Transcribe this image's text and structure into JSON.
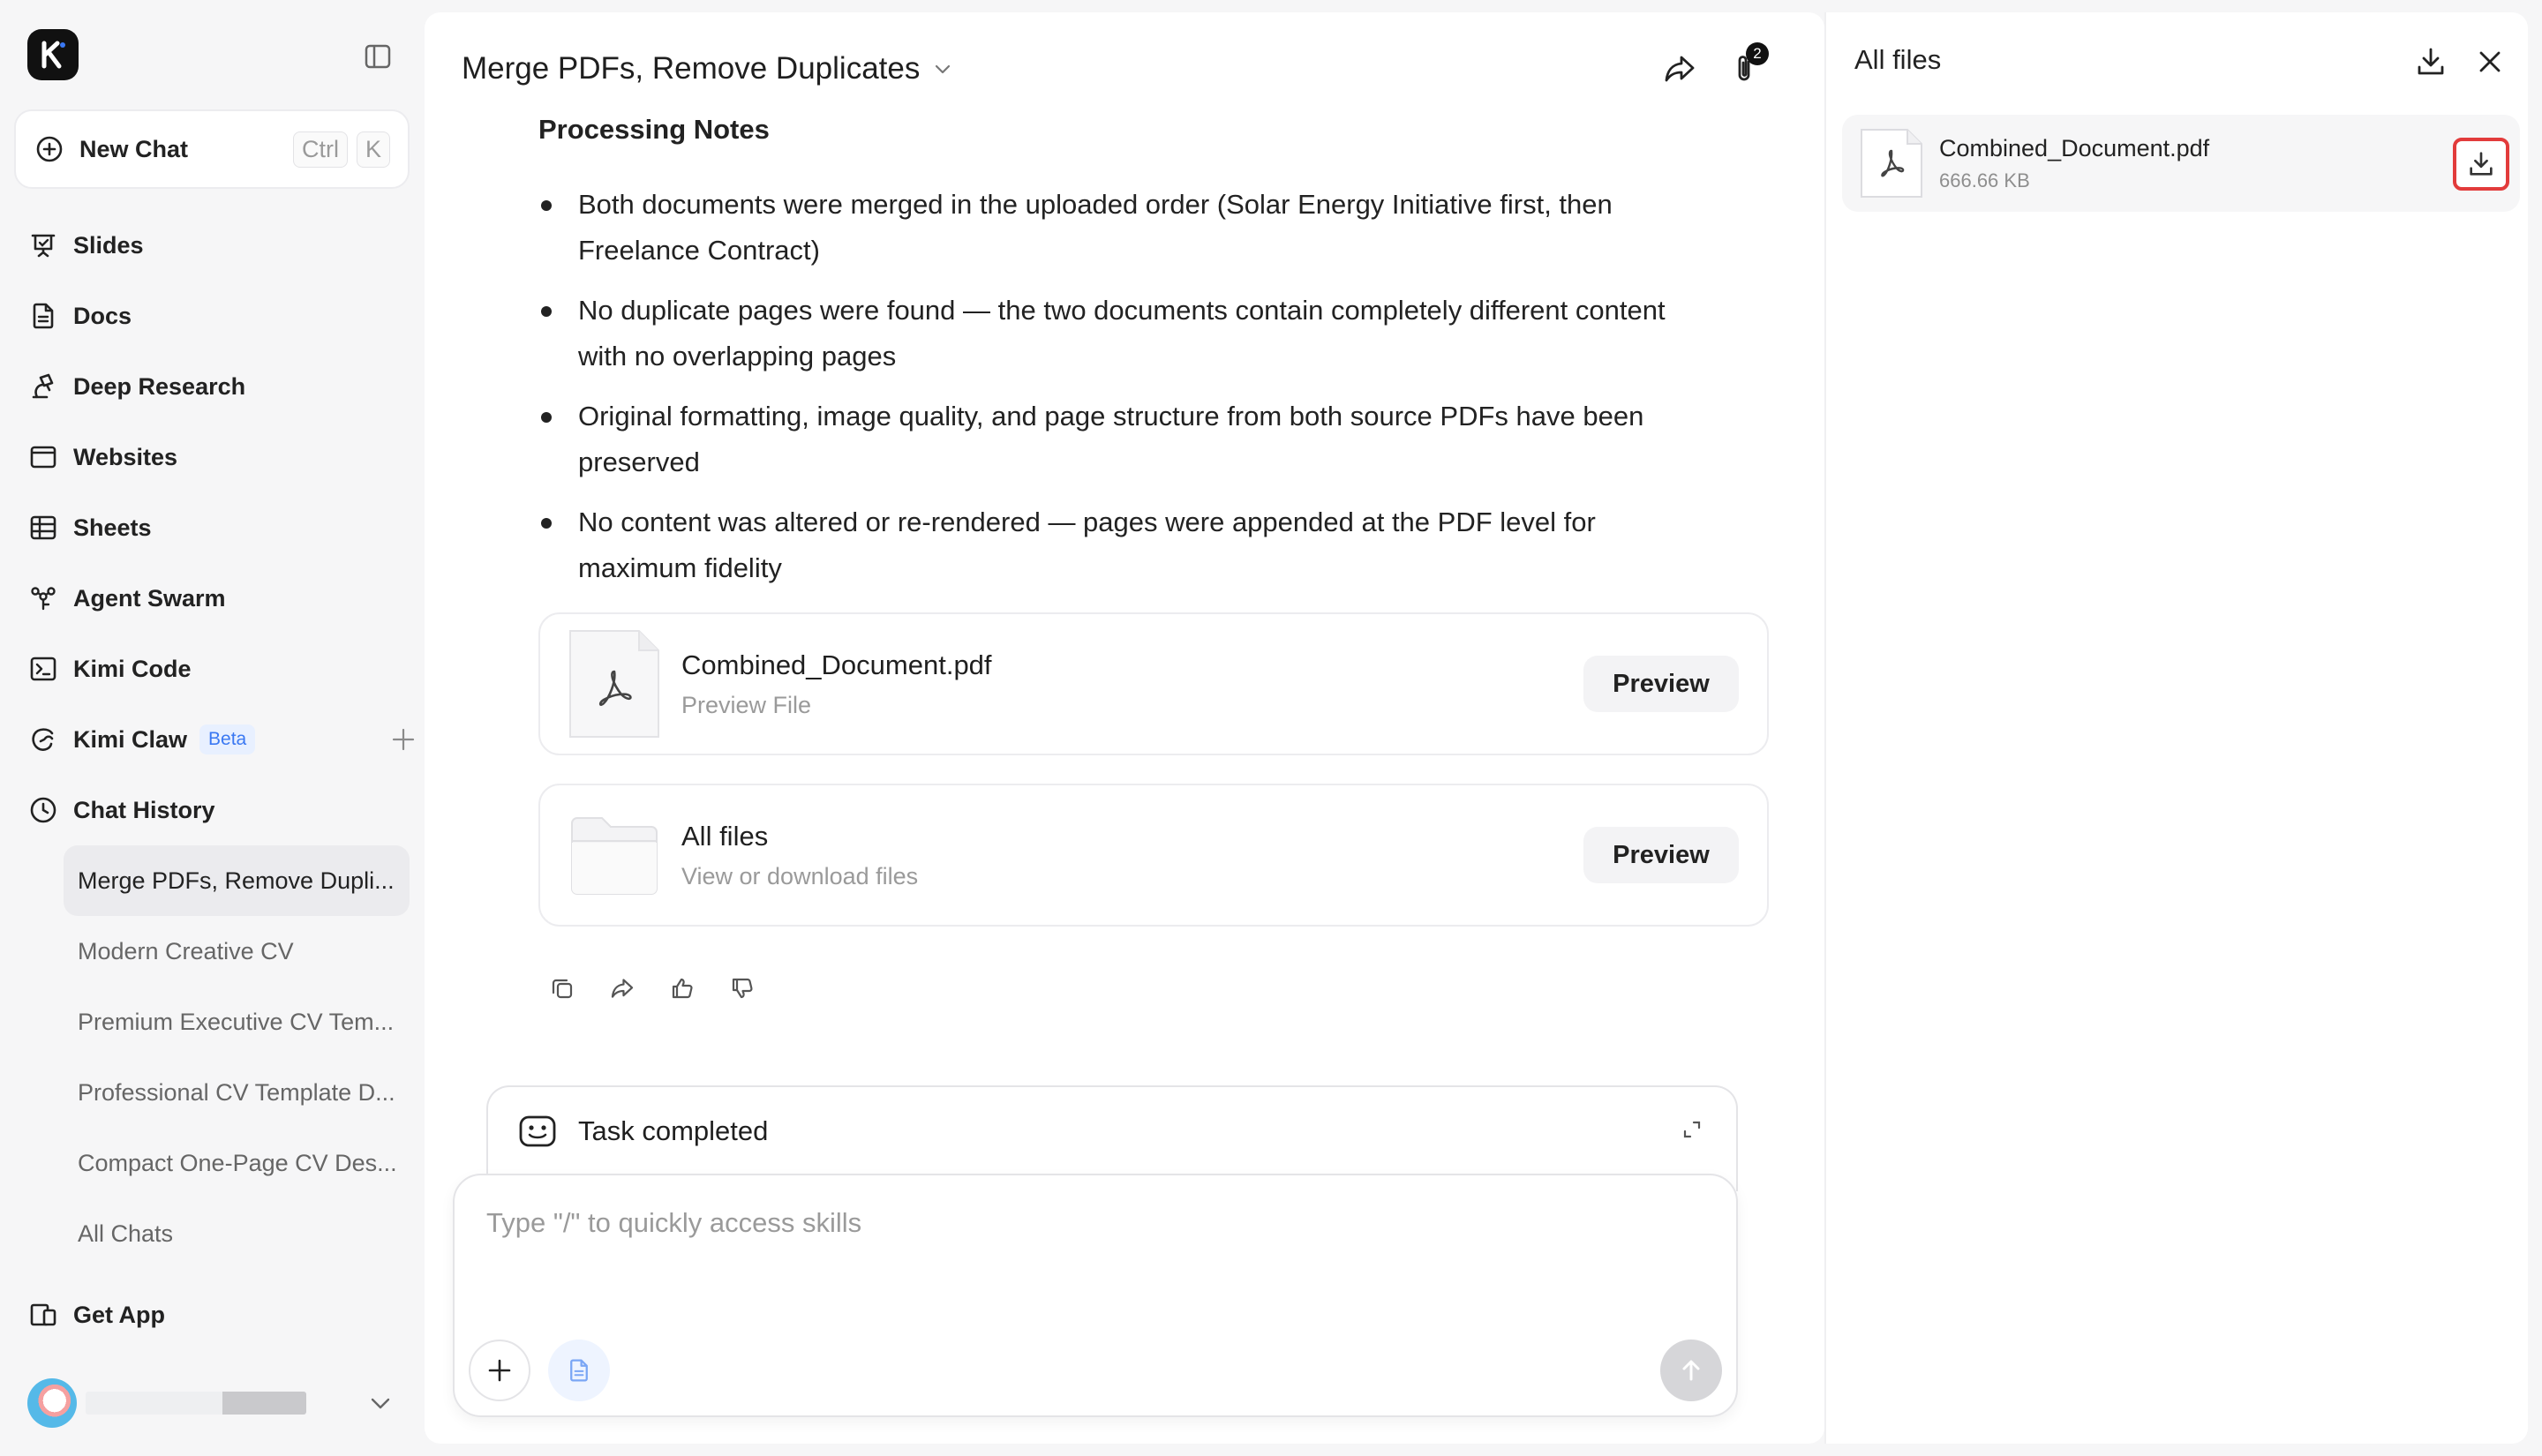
{
  "sidebar": {
    "new_chat": {
      "label": "New Chat",
      "shortcut_mod": "Ctrl",
      "shortcut_key": "K"
    },
    "nav": [
      {
        "label": "Slides",
        "icon": "slides-icon"
      },
      {
        "label": "Docs",
        "icon": "docs-icon"
      },
      {
        "label": "Deep Research",
        "icon": "deep-research-icon"
      },
      {
        "label": "Websites",
        "icon": "websites-icon"
      },
      {
        "label": "Sheets",
        "icon": "sheets-icon"
      },
      {
        "label": "Agent Swarm",
        "icon": "agent-swarm-icon"
      },
      {
        "label": "Kimi Code",
        "icon": "terminal-icon"
      },
      {
        "label": "Kimi Claw",
        "icon": "claw-icon",
        "badge": "Beta"
      },
      {
        "label": "Chat History",
        "icon": "clock-icon"
      }
    ],
    "history": [
      {
        "label": "Merge PDFs, Remove Dupli...",
        "active": true
      },
      {
        "label": "Modern Creative CV"
      },
      {
        "label": "Premium Executive CV Tem..."
      },
      {
        "label": "Professional CV Template D..."
      },
      {
        "label": "Compact One-Page CV Des..."
      },
      {
        "label": "All Chats"
      }
    ],
    "get_app": "Get App"
  },
  "header": {
    "title": "Merge PDFs, Remove Duplicates",
    "attachment_count": "2"
  },
  "content": {
    "heading": "Processing Notes",
    "notes": [
      "Both documents were merged in the uploaded order (Solar Energy Initiative first, then Freelance Contract)",
      "No duplicate pages were found — the two documents contain completely different content with no overlapping pages",
      "Original formatting, image quality, and page structure from both source PDFs have been preserved",
      "No content was altered or re-rendered — pages were appended at the PDF level for maximum fidelity"
    ],
    "cards": [
      {
        "name": "Combined_Document.pdf",
        "sub": "Preview File",
        "button": "Preview"
      },
      {
        "name": "All files",
        "sub": "View or download files",
        "button": "Preview"
      }
    ]
  },
  "task": {
    "label": "Task completed"
  },
  "composer": {
    "placeholder": "Type \"/\" to quickly access skills"
  },
  "files_panel": {
    "title": "All files",
    "items": [
      {
        "name": "Combined_Document.pdf",
        "size": "666.66 KB"
      }
    ]
  },
  "colors": {
    "accent": "#3a78f2",
    "highlight": "#e23b3b"
  }
}
